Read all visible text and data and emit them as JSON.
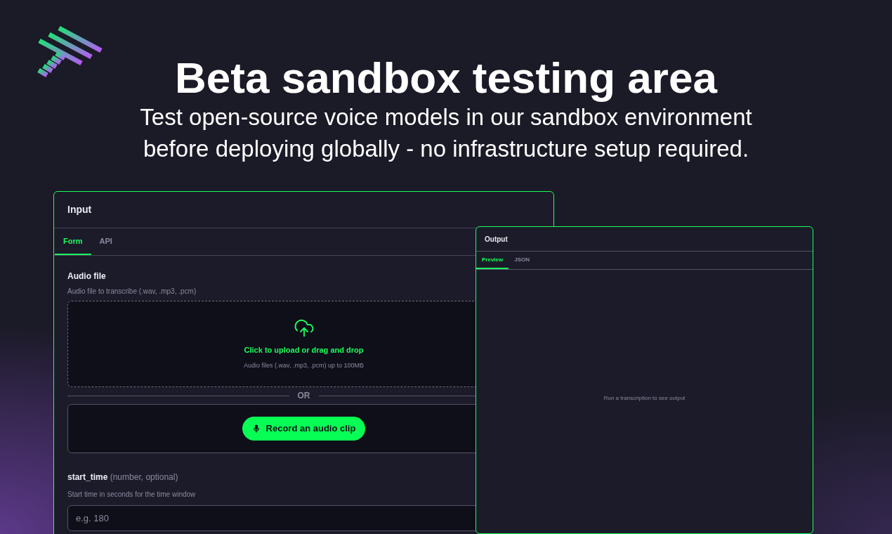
{
  "hero": {
    "title": "Beta sandbox testing area",
    "subtitle": "Test open-source voice models in our sandbox environment before deploying globally - no infrastructure setup required."
  },
  "input_panel": {
    "title": "Input",
    "tabs": [
      {
        "label": "Form",
        "selected": true
      },
      {
        "label": "API",
        "selected": false
      }
    ],
    "audio_field": {
      "label": "Audio file",
      "description": "Audio file to transcribe (.wav, .mp3, .pcm)",
      "upload_prompt": "Click to upload or drag and drop",
      "upload_hint": "Audio files (.wav, .mp3, .pcm) up to 100MB",
      "divider": "OR",
      "record_button": "Record an audio clip"
    },
    "start_time": {
      "label": "start_time",
      "type_note": "(number, optional)",
      "description": "Start time in seconds for the time window",
      "placeholder": "e.g. 180"
    }
  },
  "output_panel": {
    "title": "Output",
    "tabs": [
      {
        "label": "Preview",
        "selected": true
      },
      {
        "label": "JSON",
        "selected": false
      }
    ],
    "empty_message": "Run a transcription to see output"
  }
}
